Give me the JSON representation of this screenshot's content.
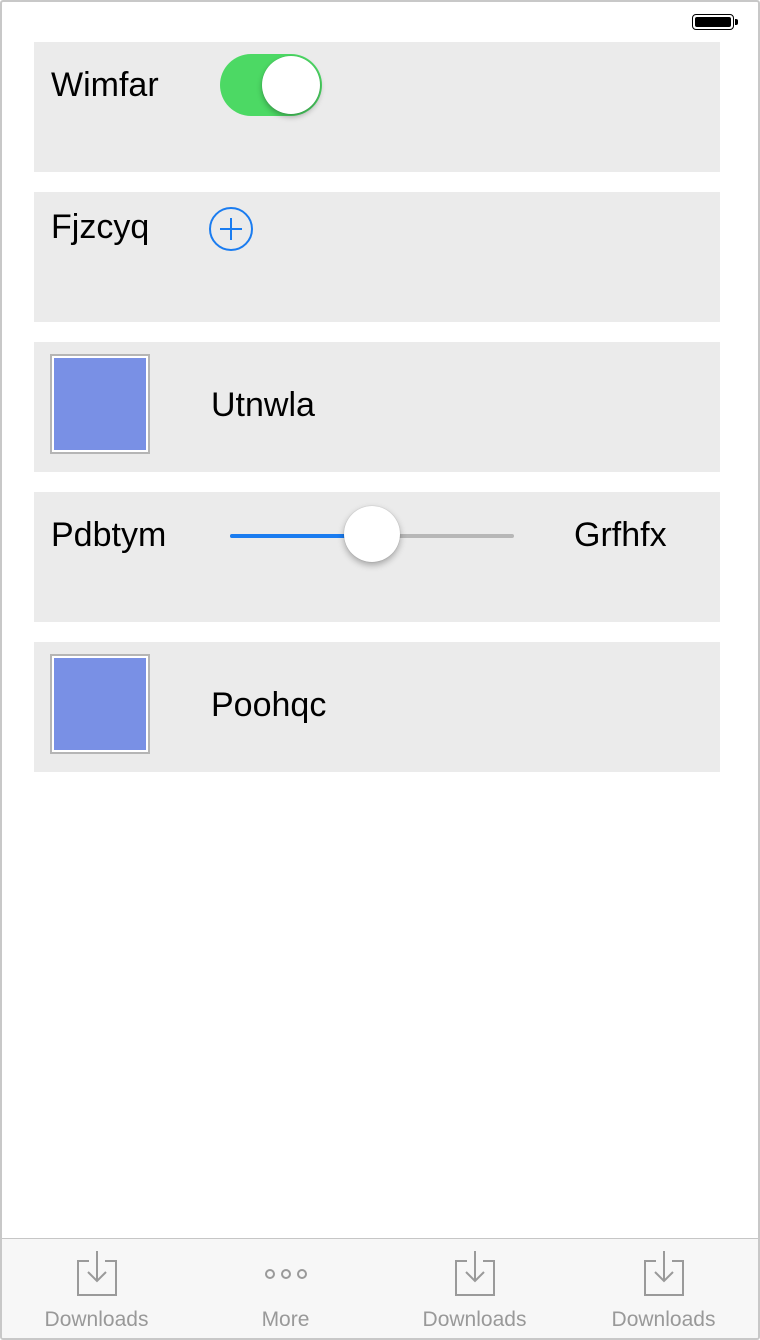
{
  "status_bar": {
    "battery_icon": "battery-full-icon"
  },
  "rows": {
    "toggle_row": {
      "label": "Wimfar",
      "toggle_on": true,
      "accent": "#4cd964"
    },
    "add_row": {
      "label": "Fjzcyq",
      "icon": "plus-circle-icon",
      "accent": "#1a7cf0"
    },
    "swatch_row_1": {
      "label": "Utnwla",
      "color": "#7990e5"
    },
    "slider_row": {
      "label_left": "Pdbtym",
      "label_right": "Grfhfx",
      "value": 0.5,
      "accent": "#1a7cf0"
    },
    "swatch_row_2": {
      "label": "Poohqc",
      "color": "#7990e5"
    }
  },
  "tabbar": {
    "tabs": [
      {
        "label": "Downloads",
        "icon": "download-icon"
      },
      {
        "label": "More",
        "icon": "more-dots-icon"
      },
      {
        "label": "Downloads",
        "icon": "download-icon"
      },
      {
        "label": "Downloads",
        "icon": "download-icon"
      }
    ]
  }
}
